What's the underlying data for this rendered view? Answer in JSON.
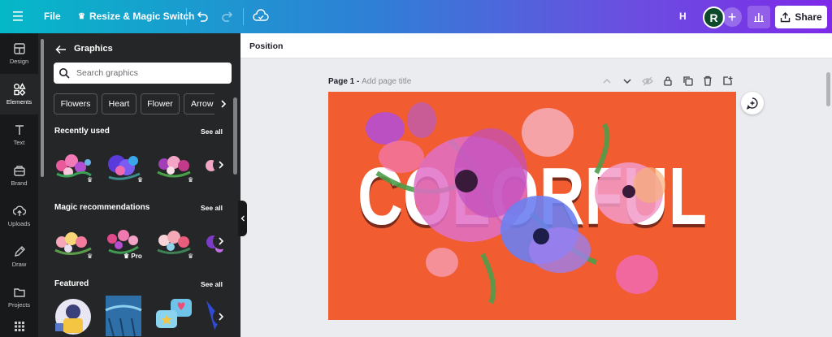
{
  "topbar": {
    "file_label": "File",
    "resize_label": "Resize & Magic Switch",
    "h_label": "H",
    "avatar_initial": "R",
    "share_label": "Share",
    "gradient_colors": [
      "#05b8c8",
      "#2f7fd6",
      "#6a4fe0",
      "#7d2ae8"
    ]
  },
  "rail": {
    "items": [
      {
        "label": "Design",
        "icon": "design-icon"
      },
      {
        "label": "Elements",
        "icon": "elements-icon"
      },
      {
        "label": "Text",
        "icon": "text-icon"
      },
      {
        "label": "Brand",
        "icon": "brand-icon"
      },
      {
        "label": "Uploads",
        "icon": "uploads-icon"
      },
      {
        "label": "Draw",
        "icon": "draw-icon"
      },
      {
        "label": "Projects",
        "icon": "projects-icon"
      }
    ]
  },
  "panel": {
    "title": "Graphics",
    "search_placeholder": "Search graphics",
    "chips": [
      "Flowers",
      "Heart",
      "Flower",
      "Arrow"
    ],
    "sections": [
      {
        "title": "Recently used",
        "see_all": "See all"
      },
      {
        "title": "Magic recommendations",
        "see_all": "See all",
        "pro_label": "Pro"
      },
      {
        "title": "Featured",
        "see_all": "See all"
      }
    ]
  },
  "context_bar": {
    "position_label": "Position"
  },
  "page": {
    "label": "Page 1 -",
    "title_placeholder": "Add page title",
    "canvas_bg": "#f15c30",
    "canvas_text": "COLORFUL"
  }
}
